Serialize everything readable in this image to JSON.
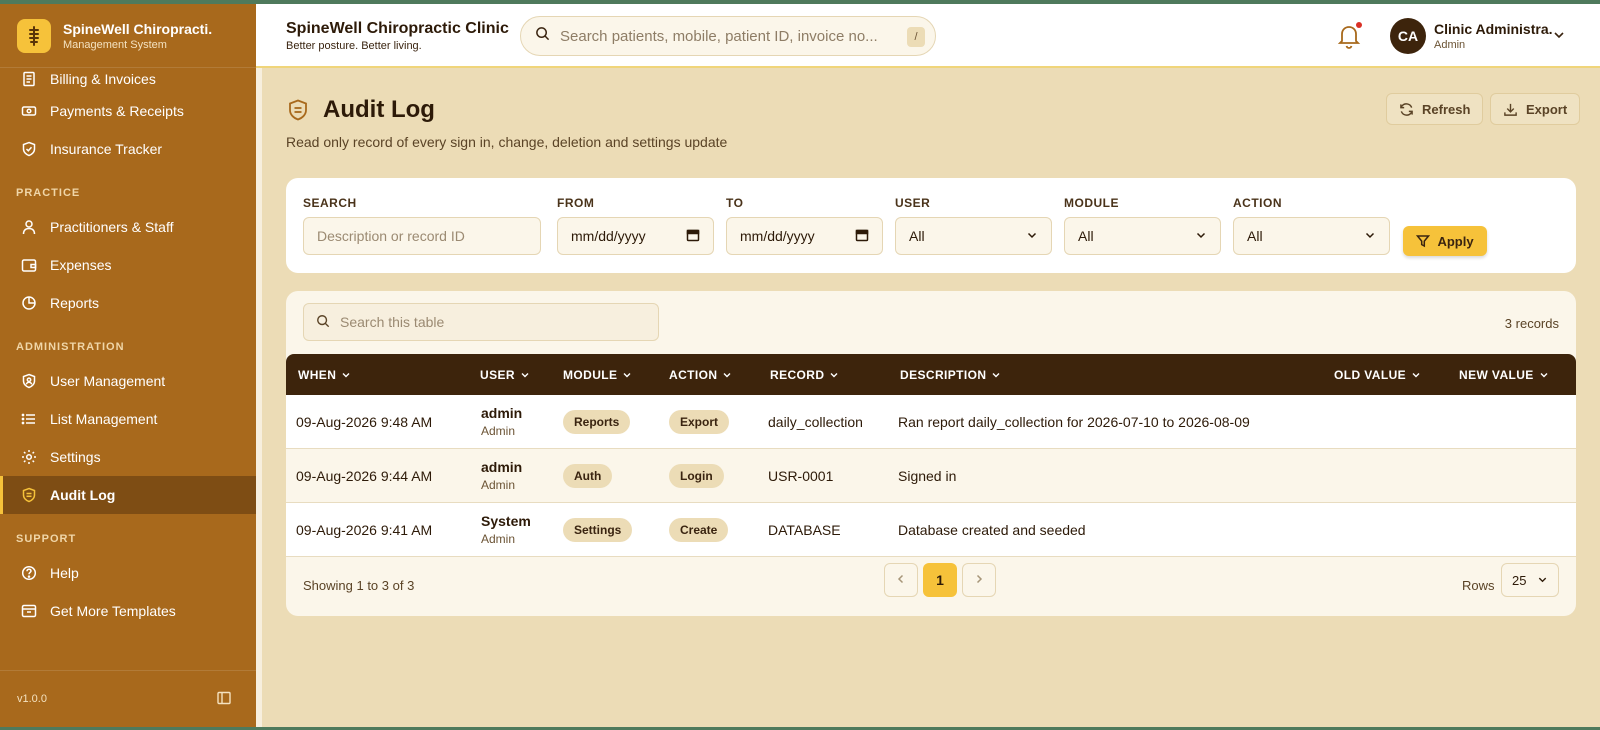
{
  "brand": {
    "name": "SpineWell Chiropracti.",
    "subtitle": "Management System"
  },
  "sidebar": {
    "items_top": [
      {
        "label": "Billing & Invoices",
        "icon": "invoice-icon"
      },
      {
        "label": "Payments & Receipts",
        "icon": "payment-icon"
      },
      {
        "label": "Insurance Tracker",
        "icon": "shield-icon"
      }
    ],
    "section_practice": "PRACTICE",
    "items_practice": [
      {
        "label": "Practitioners & Staff",
        "icon": "user-icon"
      },
      {
        "label": "Expenses",
        "icon": "wallet-icon"
      },
      {
        "label": "Reports",
        "icon": "reports-icon"
      }
    ],
    "section_admin": "ADMINISTRATION",
    "items_admin": [
      {
        "label": "User Management",
        "icon": "user-shield-icon"
      },
      {
        "label": "List Management",
        "icon": "list-icon"
      },
      {
        "label": "Settings",
        "icon": "gear-icon"
      },
      {
        "label": "Audit Log",
        "icon": "audit-icon",
        "active": true
      }
    ],
    "section_support": "SUPPORT",
    "items_support": [
      {
        "label": "Help",
        "icon": "help-icon"
      },
      {
        "label": "Get More Templates",
        "icon": "templates-icon"
      }
    ],
    "version": "v1.0.0"
  },
  "header": {
    "title": "SpineWell Chiropractic Clinic",
    "subtitle": "Better posture. Better living.",
    "search_placeholder": "Search patients, mobile, patient ID, invoice no...",
    "search_shortcut": "/",
    "user_initials": "CA",
    "user_name": "Clinic Administra.",
    "user_role": "Admin"
  },
  "page": {
    "title": "Audit Log",
    "description": "Read only record of every sign in, change, deletion and settings update",
    "refresh_label": "Refresh",
    "export_label": "Export"
  },
  "filters": {
    "search_label": "SEARCH",
    "search_placeholder": "Description or record ID",
    "from_label": "FROM",
    "from_value": "mm/dd/yyyy",
    "to_label": "TO",
    "to_value": "mm/dd/yyyy",
    "user_label": "USER",
    "user_value": "All",
    "module_label": "MODULE",
    "module_value": "All",
    "action_label": "ACTION",
    "action_value": "All",
    "apply_label": "Apply"
  },
  "table": {
    "search_placeholder": "Search this table",
    "record_count": "3 records",
    "columns": [
      "WHEN",
      "USER",
      "MODULE",
      "ACTION",
      "RECORD",
      "DESCRIPTION",
      "OLD VALUE",
      "NEW VALUE"
    ],
    "rows": [
      {
        "when": "09-Aug-2026 9:48 AM",
        "user": "admin",
        "role": "Admin",
        "module": "Reports",
        "action": "Export",
        "record": "daily_collection",
        "description": "Ran report daily_collection for 2026-07-10 to 2026-08-09",
        "old": "",
        "new": ""
      },
      {
        "when": "09-Aug-2026 9:44 AM",
        "user": "admin",
        "role": "Admin",
        "module": "Auth",
        "action": "Login",
        "record": "USR-0001",
        "description": "Signed in",
        "old": "",
        "new": ""
      },
      {
        "when": "09-Aug-2026 9:41 AM",
        "user": "System",
        "role": "Admin",
        "module": "Settings",
        "action": "Create",
        "record": "DATABASE",
        "description": "Database created and seeded",
        "old": "",
        "new": ""
      }
    ],
    "showing_text": "Showing 1 to 3 of 3",
    "current_page": "1",
    "rows_label": "Rows",
    "rows_value": "25"
  },
  "colors": {
    "sidebar": "#a8691c",
    "accent": "#f6c23a",
    "dark": "#3d240c",
    "background": "#ecdcb6"
  }
}
